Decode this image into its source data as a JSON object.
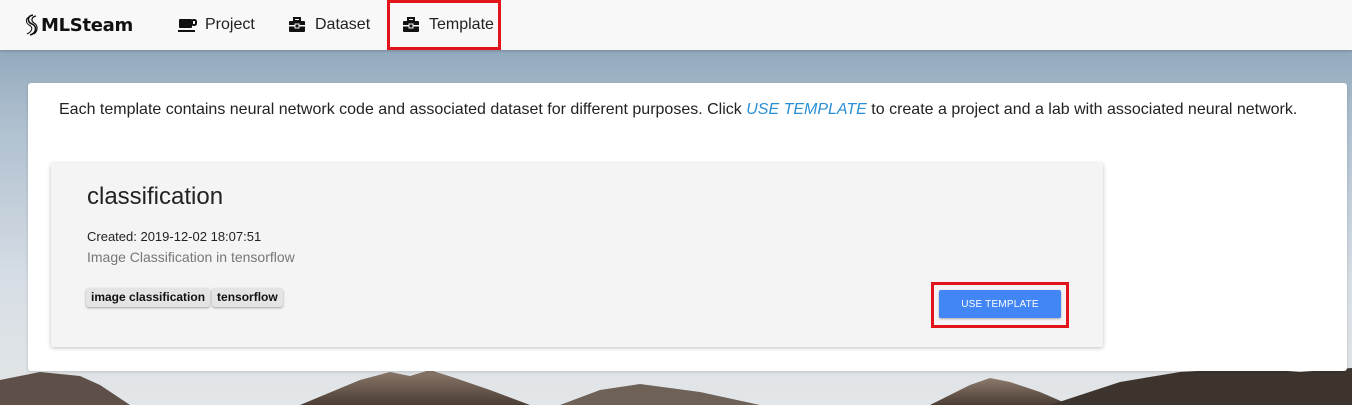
{
  "app": {
    "brand": "MLSteam",
    "accent_color": "#4285f4",
    "highlight_color": "#e0141a",
    "link_color": "#2a8fd6"
  },
  "nav": {
    "items": [
      {
        "label": "Project",
        "icon": "coffee-cup-icon"
      },
      {
        "label": "Dataset",
        "icon": "toolbox-icon"
      },
      {
        "label": "Template",
        "icon": "toolbox-icon",
        "active": true
      }
    ]
  },
  "main": {
    "intro_before": "Each template contains neural network code and associated dataset for different purposes. Click ",
    "intro_link": "USE TEMPLATE",
    "intro_after": " to create a project and a lab with associated neural network."
  },
  "templates": [
    {
      "name": "classification",
      "created": "Created: 2019-12-02 18:07:51",
      "description": "Image Classification in tensorflow",
      "tags": [
        "image classification",
        "tensorflow"
      ],
      "button_label": "USE TEMPLATE"
    }
  ]
}
